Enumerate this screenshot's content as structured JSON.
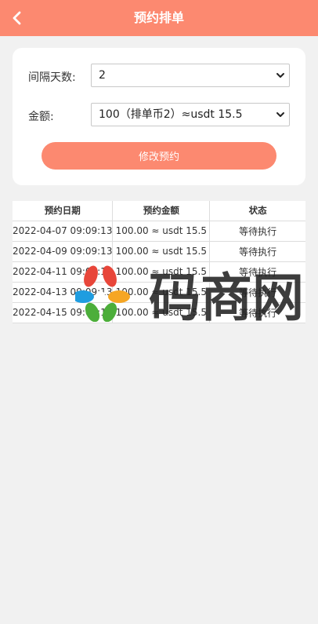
{
  "header": {
    "title": "预约排单",
    "back_icon": "chevron-left-icon"
  },
  "form": {
    "interval_label": "间隔天数:",
    "interval_value": "2",
    "amount_label": "金额:",
    "amount_value": "100（排单币2）≈usdt 15.5",
    "submit_label": "修改预约"
  },
  "table": {
    "headers": [
      "预约日期",
      "预约金额",
      "状态"
    ],
    "rows": [
      {
        "date": "2022-04-07 09:09:13",
        "amount": "100.00 ≈ usdt 15.5",
        "status": "等待执行"
      },
      {
        "date": "2022-04-09 09:09:13",
        "amount": "100.00 ≈ usdt 15.5",
        "status": "等待执行"
      },
      {
        "date": "2022-04-11 09:09:13",
        "amount": "100.00 ≈ usdt 15.5",
        "status": "等待执行"
      },
      {
        "date": "2022-04-13 09:09:13",
        "amount": "100.00 ≈ usdt 15.5",
        "status": "等待执行"
      },
      {
        "date": "2022-04-15 09:09:13",
        "amount": "100.00 ≈ usdt 15.5",
        "status": "等待执行"
      }
    ]
  },
  "watermark": {
    "text": "码商网",
    "colors": [
      "#e8463a",
      "#f6a623",
      "#4cae3a",
      "#1f9de0"
    ]
  },
  "colors": {
    "accent": "#fc8970",
    "background": "#f1f1f1"
  }
}
